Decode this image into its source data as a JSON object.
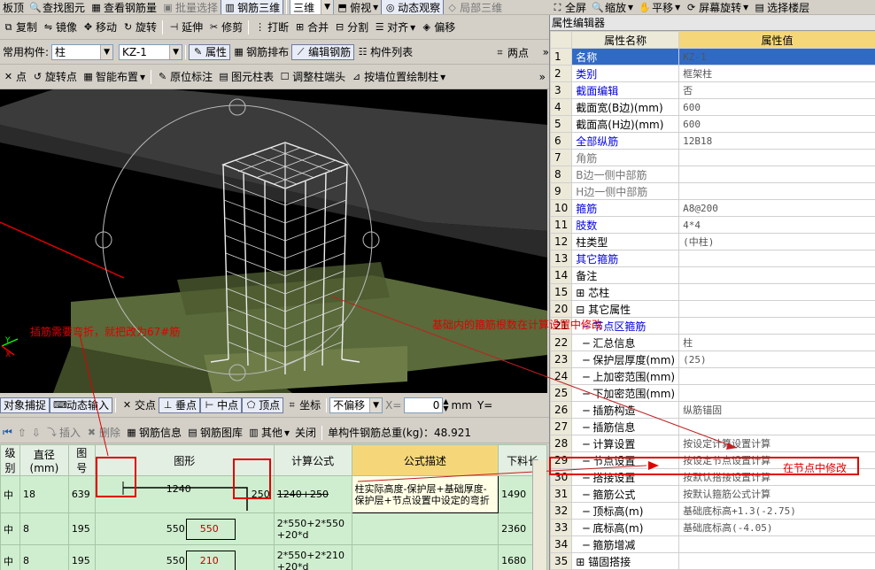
{
  "toolbar1": {
    "items": [
      "板顶",
      "查找图元",
      "查看钢筋量",
      "批量选择",
      "钢筋三维",
      "三维",
      "俯视",
      "动态观察",
      "局部三维",
      "全屏",
      "缩放",
      "平移",
      "屏幕旋转",
      "选择楼层"
    ]
  },
  "toolbar2": {
    "items": [
      "复制",
      "镜像",
      "移动",
      "旋转",
      "延伸",
      "修剪",
      "打断",
      "合并",
      "分割",
      "对齐",
      "偏移"
    ]
  },
  "toolbar3": {
    "label": "常用构件:",
    "type": "柱",
    "name": "KZ-1",
    "attr": "属性",
    "rebar_layout": "钢筋排布",
    "edit_rebar": "编辑钢筋",
    "component_list": "构件列表",
    "two_points": "两点"
  },
  "toolbar4": {
    "items": [
      "点",
      "旋转点",
      "智能布置",
      "原位标注",
      "图元柱表",
      "调整柱端头",
      "按墙位置绘制柱"
    ]
  },
  "snapbar": {
    "obj_snap": "对象捕捉",
    "dyn_input": "动态输入",
    "intersect": "交点",
    "perp": "垂点",
    "mid": "中点",
    "vertex": "顶点",
    "coord": "坐标",
    "offset_mode": "不偏移",
    "x_label": "X=",
    "x_val": "0",
    "unit": "mm",
    "y_label": "Y="
  },
  "rebar_toolbar": {
    "insert": "插入",
    "delete": "删除",
    "rebar_info": "钢筋信息",
    "rebar_lib": "钢筋图库",
    "other": "其他",
    "close": "关闭",
    "total": "单构件钢筋总重(kg)：48.921"
  },
  "grid": {
    "headers": [
      "级别",
      "直径(mm)",
      "图号",
      "图形",
      "计算公式",
      "公式描述",
      "下料长"
    ],
    "rows": [
      {
        "grade": "中",
        "dia": "18",
        "fig": "639",
        "shape": [
          "1240",
          "250"
        ],
        "formula": "1240+250",
        "desc": "柱实际高度-保护层+基础厚度-保护层+节点设置中设定的弯折",
        "len": "1490"
      },
      {
        "grade": "中",
        "dia": "8",
        "fig": "195",
        "shape": [
          "550",
          "550"
        ],
        "formula": "2*550+2*550+20*d",
        "desc": "",
        "len": "2360"
      },
      {
        "grade": "中",
        "dia": "8",
        "fig": "195",
        "shape": [
          "550",
          "210"
        ],
        "formula": "2*550+2*210+20*d",
        "desc": "",
        "len": "1680"
      }
    ]
  },
  "props": {
    "title": "属性编辑器",
    "col_name": "属性名称",
    "col_value": "属性值",
    "rows": [
      {
        "n": "1",
        "k": "名称",
        "v": "KZ-1",
        "c": "blue"
      },
      {
        "n": "2",
        "k": "类别",
        "v": "框架柱",
        "c": "blue"
      },
      {
        "n": "3",
        "k": "截面编辑",
        "v": "否",
        "c": "blue"
      },
      {
        "n": "4",
        "k": "截面宽(B边)(mm)",
        "v": "600",
        "c": ""
      },
      {
        "n": "5",
        "k": "截面高(H边)(mm)",
        "v": "600",
        "c": ""
      },
      {
        "n": "6",
        "k": "全部纵筋",
        "v": "12B18",
        "c": "blue"
      },
      {
        "n": "7",
        "k": "角筋",
        "v": "",
        "c": "gray"
      },
      {
        "n": "8",
        "k": "B边一侧中部筋",
        "v": "",
        "c": "gray"
      },
      {
        "n": "9",
        "k": "H边一侧中部筋",
        "v": "",
        "c": "gray"
      },
      {
        "n": "10",
        "k": "箍筋",
        "v": "A8@200",
        "c": "blue"
      },
      {
        "n": "11",
        "k": "肢数",
        "v": "4*4",
        "c": "blue"
      },
      {
        "n": "12",
        "k": "柱类型",
        "v": "(中柱)",
        "c": ""
      },
      {
        "n": "13",
        "k": "其它箍筋",
        "v": "",
        "c": "blue"
      },
      {
        "n": "14",
        "k": "备注",
        "v": "",
        "c": ""
      },
      {
        "n": "15",
        "k": "⊞ 芯柱",
        "v": "",
        "c": ""
      },
      {
        "n": "20",
        "k": "⊟ 其它属性",
        "v": "",
        "c": ""
      },
      {
        "n": "21",
        "k": "  ─ 节点区箍筋",
        "v": "",
        "c": "blue"
      },
      {
        "n": "22",
        "k": "  ─ 汇总信息",
        "v": "柱",
        "c": ""
      },
      {
        "n": "23",
        "k": "  ─ 保护层厚度(mm)",
        "v": "(25)",
        "c": ""
      },
      {
        "n": "24",
        "k": "  ─ 上加密范围(mm)",
        "v": "",
        "c": ""
      },
      {
        "n": "25",
        "k": "  ─ 下加密范围(mm)",
        "v": "",
        "c": ""
      },
      {
        "n": "26",
        "k": "  ─ 插筋构造",
        "v": "纵筋锚固",
        "c": ""
      },
      {
        "n": "27",
        "k": "  ─ 插筋信息",
        "v": "",
        "c": ""
      },
      {
        "n": "28",
        "k": "  ─ 计算设置",
        "v": "按设定计算设置计算",
        "c": ""
      },
      {
        "n": "29",
        "k": "  ─ 节点设置",
        "v": "按设定节点设置计算",
        "c": ""
      },
      {
        "n": "30",
        "k": "  ─ 搭接设置",
        "v": "按默认搭接设置计算",
        "c": ""
      },
      {
        "n": "31",
        "k": "  ─ 箍筋公式",
        "v": "按默认箍筋公式计算",
        "c": ""
      },
      {
        "n": "32",
        "k": "  ─ 顶标高(m)",
        "v": "基础底标高+1.3(-2.75)",
        "c": ""
      },
      {
        "n": "33",
        "k": "  ─ 底标高(m)",
        "v": "基础底标高(-4.05)",
        "c": ""
      },
      {
        "n": "34",
        "k": "  ─ 箍筋增减",
        "v": "",
        "c": ""
      },
      {
        "n": "35",
        "k": "⊞ 锚固搭接",
        "v": "",
        "c": ""
      }
    ]
  },
  "annotations": {
    "a1": "插筋需要弯折，就把改为67#筋",
    "a2": "基础内的箍筋根数在计算设置中修改",
    "a3": "在节点中修改"
  },
  "colors": {
    "annotation_red": "#e00000",
    "grid_green": "#cfeecf",
    "header_yellow": "#f5d77a"
  }
}
